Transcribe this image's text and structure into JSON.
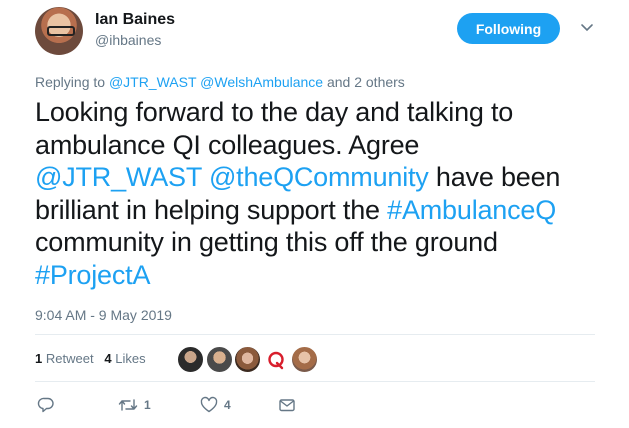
{
  "user": {
    "name": "Ian Baines",
    "handle": "@ihbaines",
    "follow_label": "Following"
  },
  "reply": {
    "prefix": "Replying to ",
    "mention1": "@JTR_WAST",
    "mention2": "@WelshAmbulance",
    "suffix": " and 2 others"
  },
  "tweet": {
    "line1": "Looking forward to the day and talking to",
    "line2": "ambulance QI colleagues. Agree",
    "mention_a": "@JTR_WAST",
    "mention_b": "@theQCommunity",
    "line3_rest": " have been",
    "line4_pre": "brilliant in helping support the ",
    "hashtag1": "#AmbulanceQ",
    "line5": "community in getting this off the ground",
    "hashtag2": "#ProjectA"
  },
  "timestamp": "9:04 AM - 9 May 2019",
  "stats": {
    "retweet_count": "1",
    "retweet_label": "Retweet",
    "like_count": "4",
    "like_label": "Likes"
  },
  "actions": {
    "retweet_count": "1",
    "like_count": "4"
  },
  "icons": {
    "reply": "reply-icon",
    "retweet": "retweet-icon",
    "like": "heart-icon",
    "dm": "envelope-icon",
    "caret": "chevron-down-icon"
  },
  "colors": {
    "accent": "#1da1f2",
    "text": "#14171a",
    "muted": "#657786",
    "q_logo": "#d81e2c"
  }
}
